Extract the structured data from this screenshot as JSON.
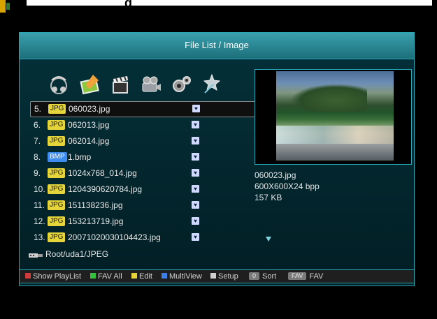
{
  "header": {
    "title": "File List / Image",
    "top_glyph": "g"
  },
  "toolbar_icons": [
    "music-icon",
    "photo-edit-icon",
    "clapper-icon",
    "camera-icon",
    "gears-icon",
    "star-wand-icon"
  ],
  "files": [
    {
      "index": "5.",
      "type": "JPG",
      "name": "060023.jpg",
      "selected": true
    },
    {
      "index": "6.",
      "type": "JPG",
      "name": "062013.jpg",
      "selected": false
    },
    {
      "index": "7.",
      "type": "JPG",
      "name": "062014.jpg",
      "selected": false
    },
    {
      "index": "8.",
      "type": "BMP",
      "name": "1.bmp",
      "selected": false
    },
    {
      "index": "9.",
      "type": "JPG",
      "name": "1024x768_014.jpg",
      "selected": false
    },
    {
      "index": "10.",
      "type": "JPG",
      "name": "1204390620784.jpg",
      "selected": false
    },
    {
      "index": "11.",
      "type": "JPG",
      "name": "151138236.jpg",
      "selected": false
    },
    {
      "index": "12.",
      "type": "JPG",
      "name": "153213719.jpg",
      "selected": false
    },
    {
      "index": "13.",
      "type": "JPG",
      "name": "20071020030104423.jpg",
      "selected": false
    }
  ],
  "preview_info": {
    "filename": "060023.jpg",
    "dimensions": "600X600X24 bpp",
    "size": "157 KB"
  },
  "path": "Root/uda1/JPEG",
  "statusbar": {
    "items": [
      {
        "label": "Show PlayList",
        "color": "#d23b3b"
      },
      {
        "label": "FAV All",
        "color": "#35c23d"
      },
      {
        "label": "Edit",
        "color": "#e7d33a"
      },
      {
        "label": "MultiView",
        "color": "#3a7ee6"
      },
      {
        "label": "Setup",
        "color": "#cfcfcf"
      }
    ],
    "sort_key": "0",
    "sort_label": "Sort",
    "fav_key": "FAV",
    "fav_label": "FAV"
  },
  "colors": {
    "panel_border": "#2aa7b6",
    "title_gradient_top": "#3aa0ad",
    "jpg_badge": "#e6d53a",
    "bmp_badge": "#3d8cf0"
  }
}
